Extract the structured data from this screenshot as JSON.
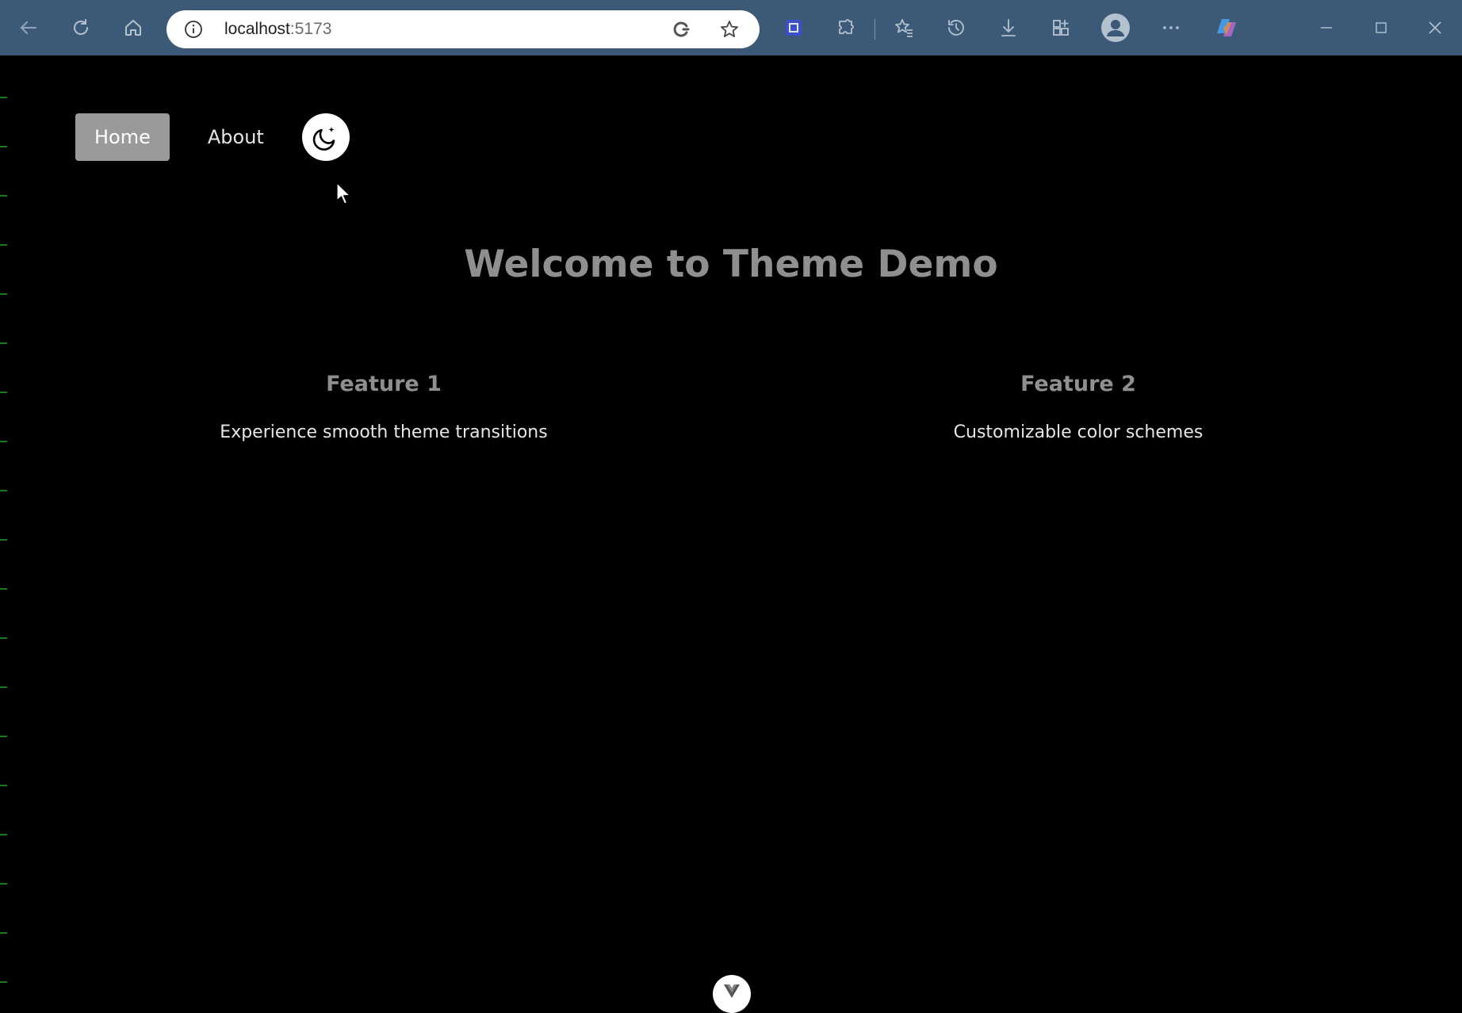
{
  "browser": {
    "url_host": "localhost",
    "url_port": ":5173",
    "icons": [
      "back-icon",
      "refresh-icon",
      "home-icon",
      "site-info-icon",
      "read-aloud-icon",
      "favorite-star-icon",
      "split-screen-icon",
      "extensions-icon",
      "favorites-icon",
      "history-icon",
      "downloads-icon",
      "collections-icon",
      "profile-icon",
      "more-icon",
      "copilot-icon",
      "minimize-icon",
      "maximize-icon",
      "close-icon"
    ]
  },
  "nav": {
    "items": [
      {
        "label": "Home",
        "active": true
      },
      {
        "label": "About",
        "active": false
      }
    ],
    "theme_toggle_icon": "moon-icon"
  },
  "hero": {
    "title": "Welcome to Theme Demo"
  },
  "features": [
    {
      "title": "Feature 1",
      "description": "Experience smooth theme transitions"
    },
    {
      "title": "Feature 2",
      "description": "Customizable color schemes"
    }
  ],
  "colors": {
    "chrome_bg": "#3c5a78",
    "page_bg": "#000000",
    "active_nav_bg": "#9a9a9a",
    "heading_gray": "#8f8f8f",
    "text_light": "#e6e6e6"
  }
}
